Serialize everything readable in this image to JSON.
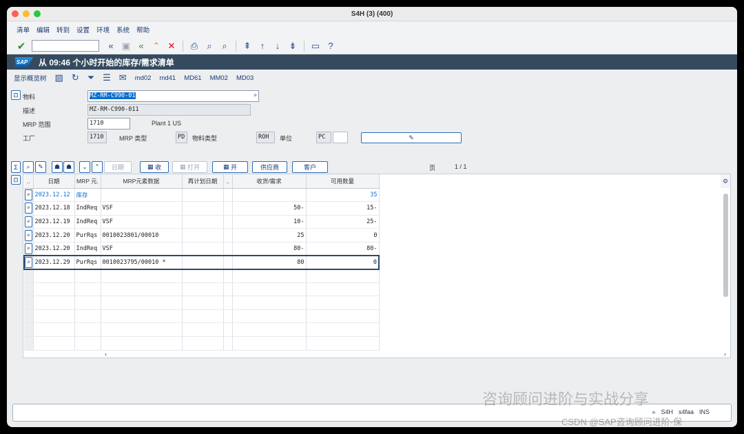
{
  "window": {
    "title": "S4H (3) (400)"
  },
  "menu": [
    "清单",
    "编辑",
    "转到",
    "设置",
    "环境",
    "系统",
    "帮助"
  ],
  "toolbar": {
    "command_value": ""
  },
  "screen": {
    "title": "从 09:46 个小时开始的库存/需求清单"
  },
  "app_toolbar": {
    "show_tree": "显示概览树",
    "tcodes": [
      "md02",
      "md41",
      "MD61",
      "MM02",
      "MD03"
    ]
  },
  "header": {
    "material_label": "物料",
    "material_value": "MZ-RM-C990-01",
    "desc_label": "描述",
    "desc_value": "MZ-RM-C990-011",
    "mrp_area_label": "MRP 范围",
    "mrp_area_value": "1710",
    "mrp_area_text": "Plant 1 US",
    "plant_label": "工厂",
    "plant_value": "1710",
    "mrp_type_label": "MRP 类型",
    "mrp_type_value": "PD",
    "mat_type_label": "物料类型",
    "mat_type_value": "ROH",
    "unit_label": "单位",
    "unit_value": "PC"
  },
  "grid_toolbar": {
    "date_btn": "日期",
    "receipt_btn": "收",
    "open_btn": "打开",
    "open2_btn": "开",
    "vendor_btn": "供应商",
    "customer_btn": "客户",
    "page_label": "页",
    "page_value": "1 /  1"
  },
  "grid": {
    "columns": [
      "..",
      "日期",
      "MRP 元.",
      "MRP元素数据",
      "再计划日期",
      "..",
      "收货/需求",
      "可用数量"
    ],
    "rows": [
      {
        "date": "2023.12.12",
        "elem": "库存",
        "data": "",
        "resched": "",
        "exc": "",
        "qty": "",
        "avail": "35",
        "blue": true
      },
      {
        "date": "2023.12.18",
        "elem": "IndReq",
        "data": "VSF",
        "resched": "",
        "exc": "",
        "qty": "50-",
        "avail": "15-"
      },
      {
        "date": "2023.12.19",
        "elem": "IndReq",
        "data": "VSF",
        "resched": "",
        "exc": "",
        "qty": "10-",
        "avail": "25-"
      },
      {
        "date": "2023.12.20",
        "elem": "PurRqs",
        "data": "0010023801/00010",
        "resched": "",
        "exc": "",
        "qty": "25",
        "avail": "0"
      },
      {
        "date": "2023.12.20",
        "elem": "IndReq",
        "data": "VSF",
        "resched": "",
        "exc": "",
        "qty": "80-",
        "avail": "80-"
      },
      {
        "date": "2023.12.29",
        "elem": "PurRqs",
        "data": "0010023795/00010 *",
        "resched": "",
        "exc": "",
        "qty": "80",
        "avail": "0",
        "current": true
      }
    ]
  },
  "status": {
    "system": "S4H",
    "server": "s4faa",
    "mode": "INS"
  },
  "watermark": {
    "line1": "咨询顾问进阶与实战分享",
    "line2": "CSDN @SAP咨询顾问进阶-保"
  }
}
